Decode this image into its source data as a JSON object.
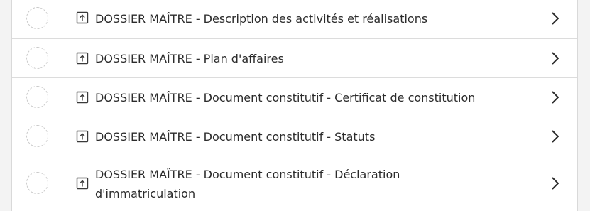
{
  "documents": [
    {
      "label": "DOSSIER MAÎTRE - Description des activités et réalisations",
      "status": "not-started",
      "icon": "upload-document-icon"
    },
    {
      "label": "DOSSIER MAÎTRE - Plan d'affaires",
      "status": "not-started",
      "icon": "upload-document-icon"
    },
    {
      "label": "DOSSIER MAÎTRE - Document constitutif - Certificat de constitution",
      "status": "not-started",
      "icon": "upload-document-icon"
    },
    {
      "label": "DOSSIER MAÎTRE - Document constitutif - Statuts",
      "status": "not-started",
      "icon": "upload-document-icon"
    },
    {
      "label": "DOSSIER MAÎTRE - Document constitutif - Déclaration d'immatriculation",
      "status": "not-started",
      "icon": "upload-document-icon"
    }
  ],
  "colors": {
    "text": "#2b2b2b",
    "divider": "#dcdcdc",
    "status_circle": "#c9c9c9",
    "icon": "#3a3a3a",
    "background": "#ffffff"
  }
}
